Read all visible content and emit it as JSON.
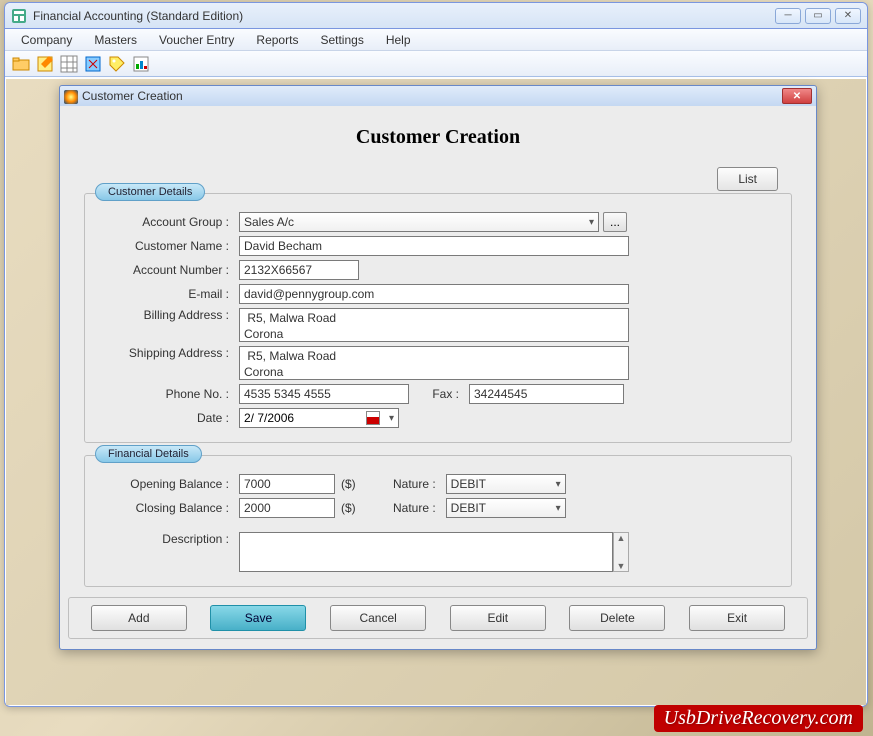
{
  "app": {
    "title": "Financial Accounting (Standard Edition)"
  },
  "menus": [
    "Company",
    "Masters",
    "Voucher Entry",
    "Reports",
    "Settings",
    "Help"
  ],
  "dialog": {
    "title": "Customer Creation",
    "heading": "Customer Creation",
    "list_btn": "List",
    "section1_legend": "Customer Details",
    "section2_legend": "Financial Details",
    "labels": {
      "account_group": "Account Group :",
      "customer_name": "Customer Name :",
      "account_number": "Account Number :",
      "email": "E-mail :",
      "billing": "Billing Address :",
      "shipping": "Shipping Address :",
      "phone": "Phone No. :",
      "fax": "Fax :",
      "date": "Date :",
      "opening": "Opening Balance :",
      "closing": "Closing Balance :",
      "nature": "Nature :",
      "description": "Description :"
    },
    "values": {
      "account_group": "Sales A/c",
      "customer_name": "David Becham",
      "account_number": "2132X66567",
      "email": "david@pennygroup.com",
      "billing": " R5, Malwa Road\nCorona",
      "shipping": " R5, Malwa Road\nCorona",
      "phone": "4535 5345 4555",
      "fax": "34244545",
      "date": " 2/  7/2006",
      "opening": "7000",
      "closing": "2000",
      "currency": "($)",
      "nature1": "DEBIT",
      "nature2": "DEBIT",
      "description": ""
    },
    "ellipsis": "...",
    "buttons": {
      "add": "Add",
      "save": "Save",
      "cancel": "Cancel",
      "edit": "Edit",
      "delete": "Delete",
      "exit": "Exit"
    }
  },
  "watermark": "UsbDriveRecovery.com"
}
